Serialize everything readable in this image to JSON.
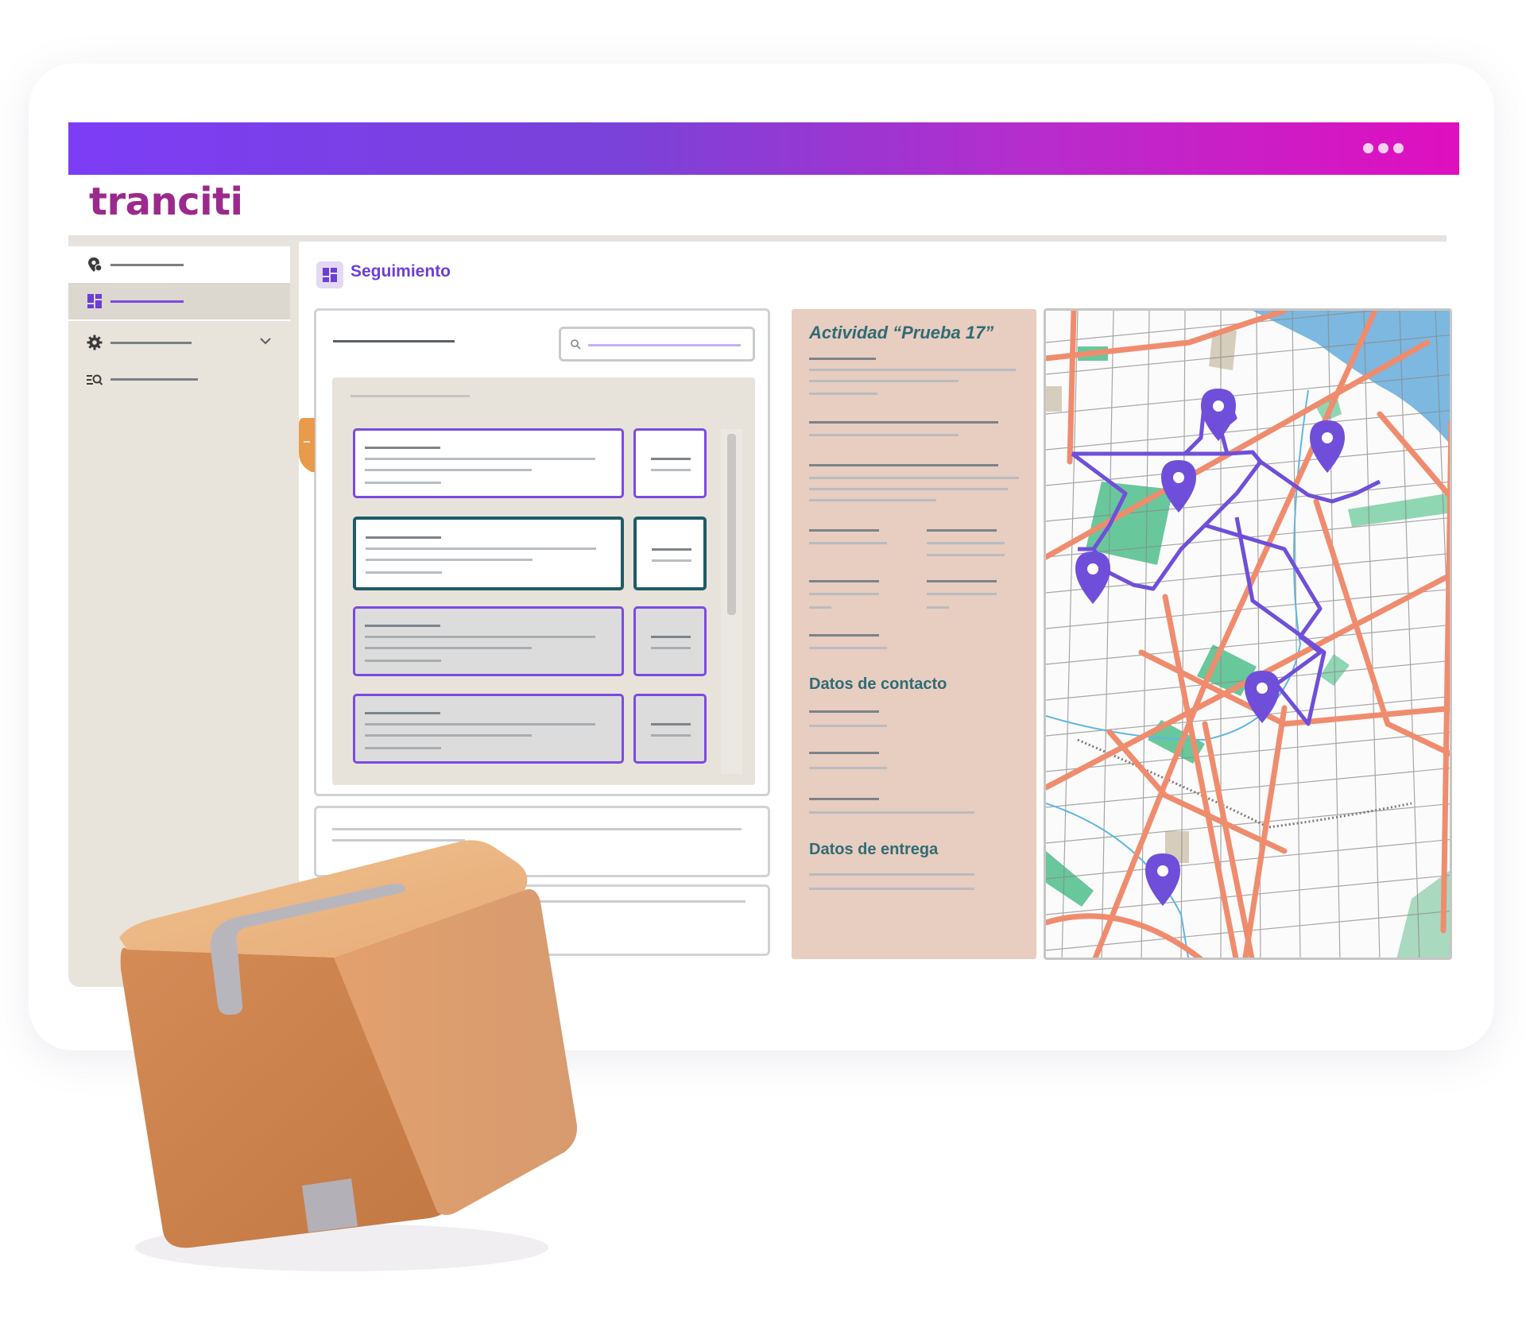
{
  "app": {
    "logo_text": "tranciti"
  },
  "sidebar": {
    "items": [
      {
        "icon": "location-gear-icon",
        "active": false
      },
      {
        "icon": "dashboard-icon",
        "active": true
      },
      {
        "icon": "gear-icon",
        "active": false,
        "expandable": true
      },
      {
        "icon": "search-list-icon",
        "active": false
      }
    ]
  },
  "main": {
    "title": "Seguimiento",
    "title_icon": "dashboard-icon"
  },
  "detail": {
    "title": "Actividad “Prueba 17”",
    "contact_label": "Datos de contacto",
    "delivery_label": "Datos de entrega"
  },
  "colors": {
    "header_gradient_start": "#7c3df5",
    "header_gradient_end": "#df0fc0",
    "accent_purple": "#7a4be0",
    "selected_teal": "#1e5c67",
    "detail_bg": "#e8cdc1",
    "sidebar_bg": "#e8e4dc"
  },
  "map": {
    "pin_count": 6
  }
}
